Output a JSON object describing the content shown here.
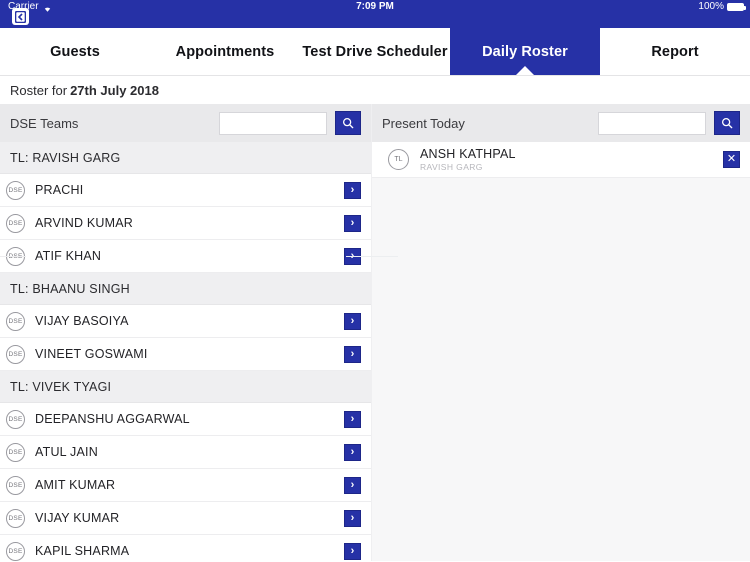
{
  "status_bar": {
    "carrier": "Carrier",
    "wifi_icon": "wifi-icon",
    "time": "7:09 PM",
    "battery_percent": "100%",
    "battery_icon": "battery-full-icon",
    "app_icon": "app-launch-icon"
  },
  "tabs": [
    {
      "label": "Guests",
      "active": false
    },
    {
      "label": "Appointments",
      "active": false
    },
    {
      "label": "Test Drive Scheduler",
      "active": false
    },
    {
      "label": "Daily Roster",
      "active": true
    },
    {
      "label": "Report",
      "active": false
    }
  ],
  "roster": {
    "prefix": "Roster for",
    "date": "27th July 2018"
  },
  "left_pane": {
    "header_label": "DSE Teams",
    "search": {
      "value": "",
      "placeholder": ""
    },
    "search_button_icon": "search-icon",
    "groups": [
      {
        "title": "TL: RAVISH GARG",
        "members": [
          {
            "badge": "DSE",
            "name": "PRACHI",
            "action_icon": "chevron-right-icon"
          },
          {
            "badge": "DSE",
            "name": "ARVIND KUMAR",
            "action_icon": "chevron-right-icon"
          },
          {
            "badge": "DSE",
            "name": "ATIF KHAN",
            "action_icon": "chevron-right-icon"
          }
        ]
      },
      {
        "title": "TL: BHAANU SINGH",
        "members": [
          {
            "badge": "DSE",
            "name": "VIJAY BASOIYA",
            "action_icon": "chevron-right-icon"
          },
          {
            "badge": "DSE",
            "name": "VINEET GOSWAMI",
            "action_icon": "chevron-right-icon"
          }
        ]
      },
      {
        "title": "TL: VIVEK TYAGI",
        "members": [
          {
            "badge": "DSE",
            "name": "DEEPANSHU AGGARWAL",
            "action_icon": "chevron-right-icon"
          },
          {
            "badge": "DSE",
            "name": "ATUL JAIN",
            "action_icon": "chevron-right-icon"
          },
          {
            "badge": "DSE",
            "name": "AMIT KUMAR",
            "action_icon": "chevron-right-icon"
          },
          {
            "badge": "DSE",
            "name": "VIJAY KUMAR",
            "action_icon": "chevron-right-icon"
          },
          {
            "badge": "DSE",
            "name": "KAPIL SHARMA",
            "action_icon": "chevron-right-icon"
          }
        ]
      }
    ]
  },
  "right_pane": {
    "header_label": "Present Today",
    "search": {
      "value": "",
      "placeholder": ""
    },
    "search_button_icon": "search-icon",
    "entries": [
      {
        "badge": "TL",
        "name": "ANSH KATHPAL",
        "subtitle": "RAVISH GARG",
        "action_icon": "close-icon",
        "action_glyph": "✕"
      }
    ]
  },
  "colors": {
    "brand_blue": "#2631A6",
    "tab_text": "#111216",
    "pane_header_bg": "#e9e9eb",
    "group_header_bg": "#efeff1",
    "right_pane_bg": "#f7f7f8"
  }
}
